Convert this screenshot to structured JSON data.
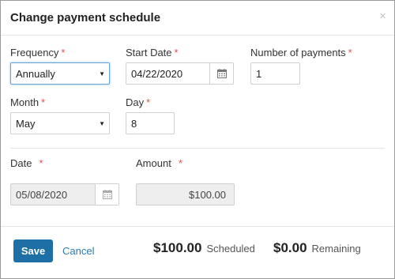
{
  "dialog": {
    "title": "Change payment schedule",
    "close_glyph": "×"
  },
  "form": {
    "frequency": {
      "label": "Frequency",
      "required_mark": "*",
      "value": "Annually",
      "icon": "chevron-down-icon"
    },
    "start_date": {
      "label": "Start Date",
      "required_mark": "*",
      "value": "04/22/2020",
      "icon": "calendar-icon"
    },
    "number_of_payments": {
      "label": "Number of payments",
      "required_mark": "*",
      "value": "1"
    },
    "month": {
      "label": "Month",
      "required_mark": "*",
      "value": "May",
      "icon": "chevron-down-icon"
    },
    "day": {
      "label": "Day",
      "required_mark": "*",
      "value": "8"
    },
    "date": {
      "label": "Date",
      "required_mark": "*",
      "value": "05/08/2020",
      "icon": "calendar-icon"
    },
    "amount": {
      "label": "Amount",
      "required_mark": "*",
      "value": "$100.00"
    }
  },
  "footer": {
    "save_label": "Save",
    "cancel_label": "Cancel",
    "scheduled_amount": "$100.00",
    "scheduled_label": "Scheduled",
    "remaining_amount": "$0.00",
    "remaining_label": "Remaining"
  },
  "colors": {
    "primary": "#1e6fa6",
    "link": "#2a7ab5",
    "required": "#d9534f"
  }
}
